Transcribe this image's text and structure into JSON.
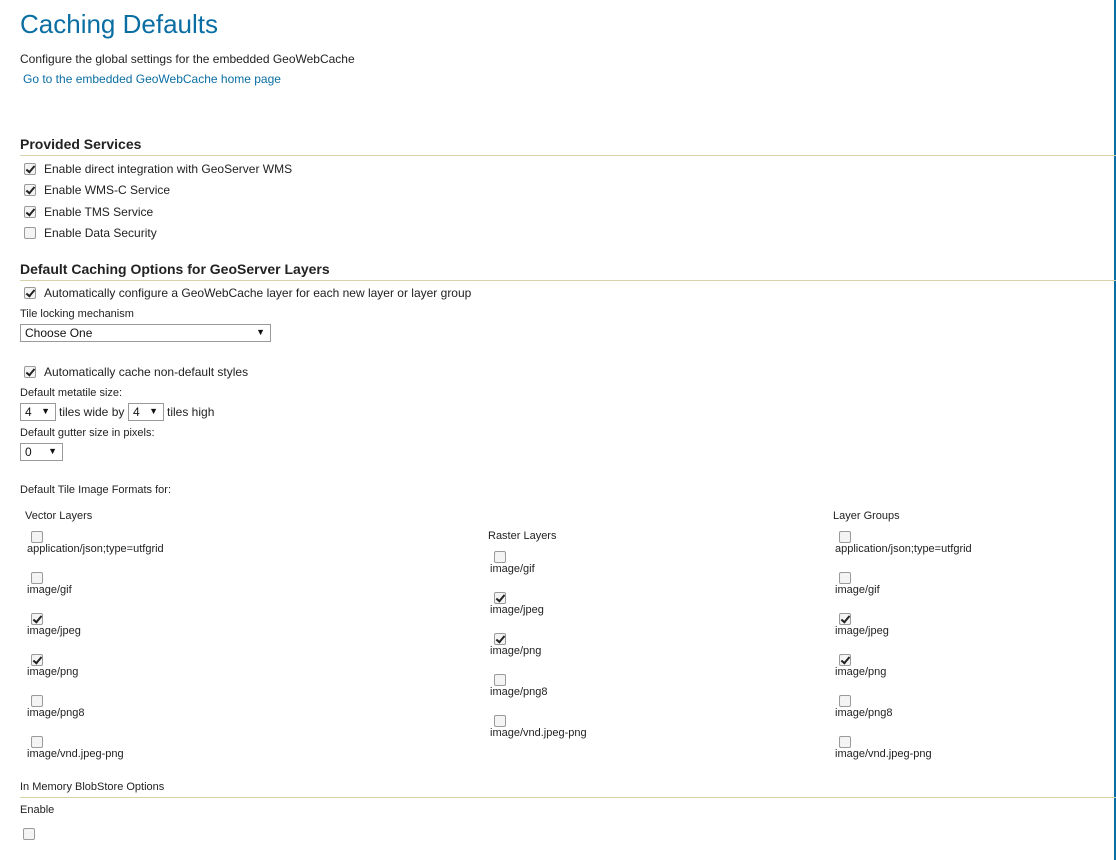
{
  "header": {
    "title": "Caching Defaults",
    "description": "Configure the global settings for the embedded GeoWebCache",
    "home_link": "Go to the embedded GeoWebCache home page"
  },
  "provided_services": {
    "title": "Provided Services",
    "items": [
      {
        "label": "Enable direct integration with GeoServer WMS",
        "checked": true
      },
      {
        "label": "Enable WMS-C Service",
        "checked": true
      },
      {
        "label": "Enable TMS Service",
        "checked": true
      },
      {
        "label": "Enable Data Security",
        "checked": false
      }
    ]
  },
  "default_caching": {
    "title": "Default Caching Options for GeoServer Layers",
    "auto_configure_label": "Automatically configure a GeoWebCache layer for each new layer or layer group",
    "auto_configure_checked": true,
    "tile_locking_label": "Tile locking mechanism",
    "tile_locking_value": "Choose One",
    "auto_cache_styles_label": "Automatically cache non-default styles",
    "auto_cache_styles_checked": true,
    "metatile_label": "Default metatile size:",
    "metatile_wide_value": "4",
    "tiles_wide_by": "tiles wide by",
    "metatile_high_value": "4",
    "tiles_high": "tiles high",
    "gutter_label": "Default gutter size in pixels:",
    "gutter_value": "0",
    "formats_label": "Default Tile Image Formats for:"
  },
  "formats": {
    "vector": {
      "title": "Vector Layers",
      "items": [
        {
          "label": "application/json;type=utfgrid",
          "checked": false
        },
        {
          "label": "image/gif",
          "checked": false
        },
        {
          "label": "image/jpeg",
          "checked": true
        },
        {
          "label": "image/png",
          "checked": true
        },
        {
          "label": "image/png8",
          "checked": false
        },
        {
          "label": "image/vnd.jpeg-png",
          "checked": false
        }
      ]
    },
    "raster": {
      "title": "Raster Layers",
      "items": [
        {
          "label": "image/gif",
          "checked": false
        },
        {
          "label": "image/jpeg",
          "checked": true
        },
        {
          "label": "image/png",
          "checked": true
        },
        {
          "label": "image/png8",
          "checked": false
        },
        {
          "label": "image/vnd.jpeg-png",
          "checked": false
        }
      ]
    },
    "groups": {
      "title": "Layer Groups",
      "items": [
        {
          "label": "application/json;type=utfgrid",
          "checked": false
        },
        {
          "label": "image/gif",
          "checked": false
        },
        {
          "label": "image/jpeg",
          "checked": true
        },
        {
          "label": "image/png",
          "checked": true
        },
        {
          "label": "image/png8",
          "checked": false
        },
        {
          "label": "image/vnd.jpeg-png",
          "checked": false
        }
      ]
    }
  },
  "blobstore": {
    "title": "In Memory BlobStore Options",
    "enable_label": "Enable",
    "enable_checked": false
  },
  "colors": {
    "accent": "#0b6ea3",
    "rule": "#d6d3a8"
  }
}
